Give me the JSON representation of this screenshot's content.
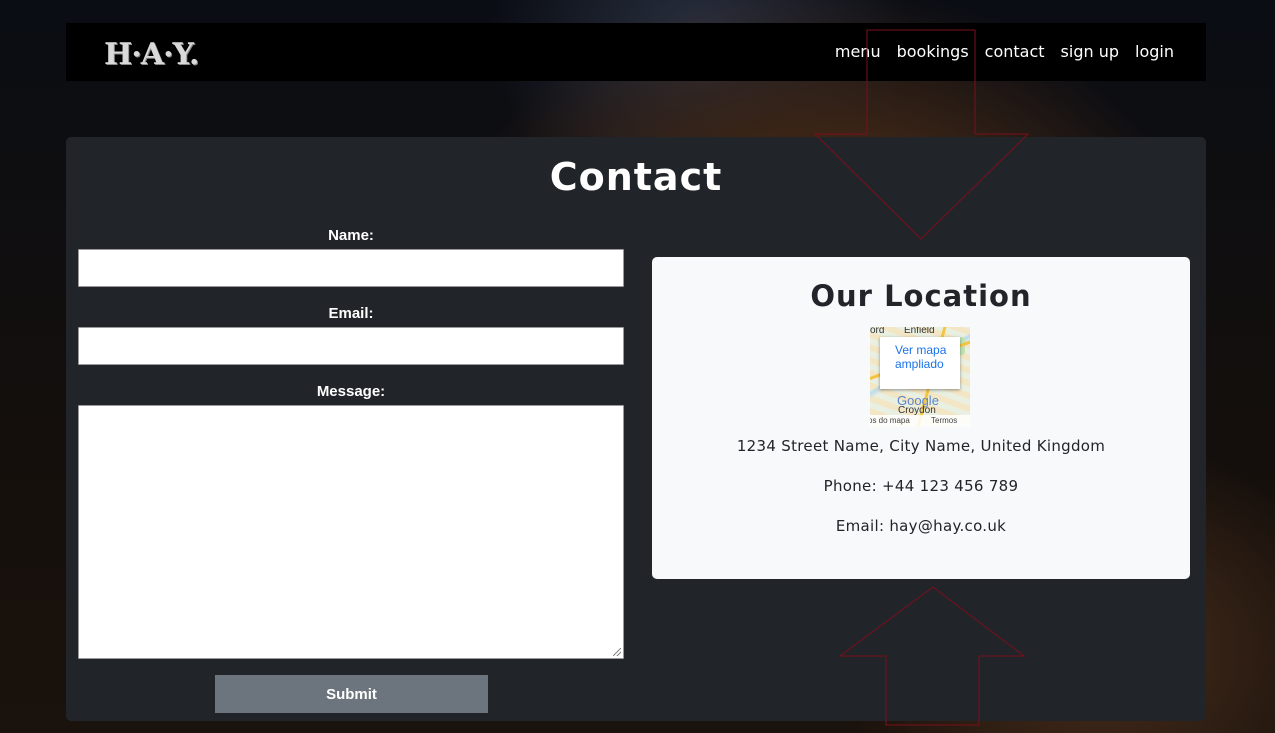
{
  "brand": {
    "logo": "H·A·Y."
  },
  "nav": {
    "items": [
      {
        "label": "menu"
      },
      {
        "label": "bookings"
      },
      {
        "label": "contact"
      },
      {
        "label": "sign up"
      },
      {
        "label": "login"
      }
    ]
  },
  "contact": {
    "title": "Contact",
    "form": {
      "name_label": "Name:",
      "name_value": "",
      "email_label": "Email:",
      "email_value": "",
      "message_label": "Message:",
      "message_value": "",
      "submit_label": "Submit"
    },
    "location": {
      "title": "Our Location",
      "map": {
        "town_top": "Enfield",
        "town_left": "ord",
        "town_bottom": "Croydon",
        "popup_link": "Ver mapa ampliado",
        "brand": "Google",
        "footer_data": "os do mapa",
        "footer_terms": "Termos"
      },
      "address": "1234 Street Name, City Name, United Kingdom",
      "phone": "Phone: +44 123 456 789",
      "email": "Email: hay@hay.co.uk"
    }
  },
  "colors": {
    "navbar_bg": "#000000",
    "card_bg": "#212529",
    "location_bg": "#f8f9fa",
    "submit_bg": "#6c757d",
    "map_link": "#1a73e8",
    "arrow_stroke": "#7a0f1c"
  }
}
